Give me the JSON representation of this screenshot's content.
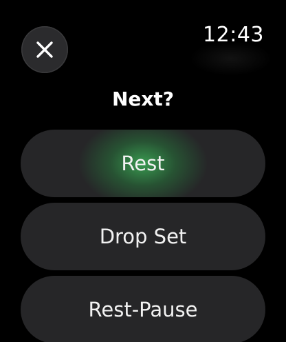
{
  "status": {
    "time": "12:43"
  },
  "header": {
    "close_icon": "close-icon",
    "prompt": "Next?"
  },
  "options": [
    {
      "label": "Rest",
      "highlighted": true
    },
    {
      "label": "Drop Set",
      "highlighted": false
    },
    {
      "label": "Rest-Pause",
      "highlighted": false
    }
  ],
  "colors": {
    "background": "#000000",
    "button": "#262628",
    "highlight": "#3aa052",
    "text": "#ffffff"
  }
}
